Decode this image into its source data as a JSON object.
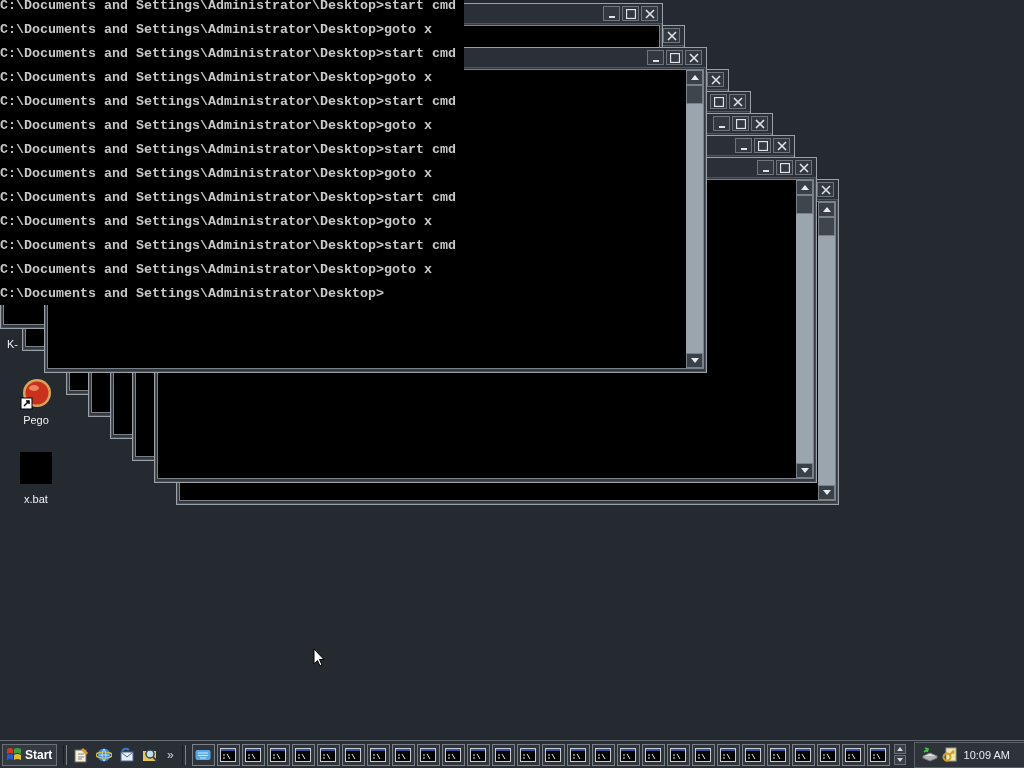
{
  "windows": [
    {
      "kind": "console"
    },
    {
      "kind": "console"
    },
    {
      "kind": "console"
    },
    {
      "kind": "console"
    },
    {
      "kind": "console"
    },
    {
      "kind": "console"
    },
    {
      "kind": "console"
    },
    {
      "kind": "console"
    },
    {
      "kind": "console"
    }
  ],
  "console_lines": [
    "C:\\Documents and Settings\\Administrator\\Desktop>start cmd",
    "C:\\Documents and Settings\\Administrator\\Desktop>goto x",
    "C:\\Documents and Settings\\Administrator\\Desktop>start cmd",
    "C:\\Documents and Settings\\Administrator\\Desktop>goto x",
    "C:\\Documents and Settings\\Administrator\\Desktop>start cmd",
    "C:\\Documents and Settings\\Administrator\\Desktop>goto x",
    "C:\\Documents and Settings\\Administrator\\Desktop>start cmd",
    "C:\\Documents and Settings\\Administrator\\Desktop>goto x",
    "C:\\Documents and Settings\\Administrator\\Desktop>start cmd",
    "C:\\Documents and Settings\\Administrator\\Desktop>goto x",
    "C:\\Documents and Settings\\Administrator\\Desktop>start cmd",
    "C:\\Documents and Settings\\Administrator\\Desktop>goto x",
    "C:\\Documents and Settings\\Administrator\\Desktop>"
  ],
  "desktop_icons": [
    {
      "label": "K-",
      "kind": "hidden"
    },
    {
      "label": "Pego",
      "kind": "shortcut"
    },
    {
      "label": "x.bat",
      "kind": "batch"
    }
  ],
  "taskbar": {
    "start": "Start",
    "chevron": "»",
    "quick_launch": [
      {
        "kind": "page"
      },
      {
        "kind": "globe"
      },
      {
        "kind": "envelope"
      },
      {
        "kind": "search"
      }
    ],
    "tasks": [
      {
        "kind": "keyboard"
      },
      {
        "kind": "console"
      },
      {
        "kind": "console"
      },
      {
        "kind": "console"
      },
      {
        "kind": "console"
      },
      {
        "kind": "console"
      },
      {
        "kind": "console"
      },
      {
        "kind": "console"
      },
      {
        "kind": "console"
      },
      {
        "kind": "console"
      },
      {
        "kind": "console"
      },
      {
        "kind": "console"
      },
      {
        "kind": "console"
      },
      {
        "kind": "console"
      },
      {
        "kind": "console"
      },
      {
        "kind": "console"
      },
      {
        "kind": "console"
      },
      {
        "kind": "console"
      },
      {
        "kind": "console"
      },
      {
        "kind": "console"
      },
      {
        "kind": "console"
      },
      {
        "kind": "console"
      },
      {
        "kind": "console"
      },
      {
        "kind": "console"
      },
      {
        "kind": "console"
      },
      {
        "kind": "console"
      },
      {
        "kind": "console"
      },
      {
        "kind": "console"
      }
    ],
    "clock": "10:09 AM"
  }
}
